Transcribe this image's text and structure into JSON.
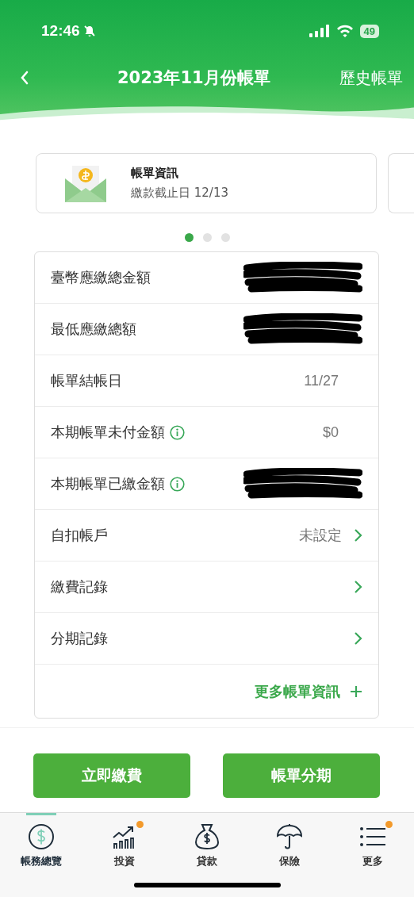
{
  "status_bar": {
    "time": "12:46",
    "battery": "49"
  },
  "nav": {
    "title": "2023年11月份帳單",
    "action": "歷史帳單"
  },
  "cards": [
    {
      "title": "帳單資訊",
      "subtitle": "繳款截止日 12/13"
    }
  ],
  "pager": [
    {
      "selected": true
    },
    {
      "selected": false
    },
    {
      "selected": false
    }
  ],
  "rows": [
    {
      "label": "臺幣應繳總金額",
      "kind": "redacted",
      "info": false
    },
    {
      "label": "最低應繳總額",
      "kind": "redacted",
      "info": false
    },
    {
      "label": "帳單結帳日",
      "kind": "value",
      "value": "11/27",
      "info": false
    },
    {
      "label": "本期帳單未付金額",
      "kind": "value",
      "value": "$0",
      "info": true
    },
    {
      "label": "本期帳單已繳金額",
      "kind": "redacted",
      "info": true
    },
    {
      "label": "自扣帳戶",
      "kind": "link",
      "value": "未設定",
      "info": false
    },
    {
      "label": "繳費記錄",
      "kind": "link",
      "info": false
    },
    {
      "label": "分期記錄",
      "kind": "link",
      "info": false
    }
  ],
  "more_link": "更多帳單資訊",
  "buttons": [
    "立即繳費",
    "帳單分期"
  ],
  "tabs": [
    {
      "label": "帳務總覽",
      "selected": true,
      "badge": false
    },
    {
      "label": "投資",
      "selected": false,
      "badge": true
    },
    {
      "label": "貸款",
      "selected": false,
      "badge": false
    },
    {
      "label": "保險",
      "selected": false,
      "badge": false
    },
    {
      "label": "更多",
      "selected": false,
      "badge": true
    }
  ]
}
